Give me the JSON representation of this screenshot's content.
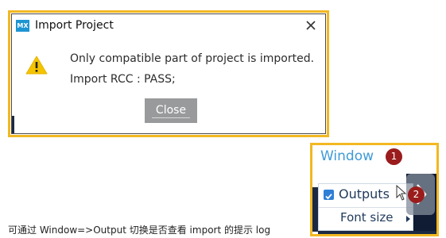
{
  "dialog": {
    "title": "Import Project",
    "app_icon_text": "MX",
    "message_line1": "Only compatible part of project is imported.",
    "message_line2": "Import RCC : PASS;",
    "close_button_label": "Close",
    "close_icon": "close-icon",
    "warning_icon": "warning-icon"
  },
  "window_menu": {
    "title": "Window",
    "badge1": "1",
    "badge2": "2",
    "outputs_label": "Outputs",
    "outputs_checked": true,
    "font_size_label": "Font size"
  },
  "caption": "可通过 Window=>Output 切换是否查看 import 的提示 log",
  "colors": {
    "highlight_border": "#f2b822",
    "mx_icon": "#1e95d3",
    "warning": "#f5c400",
    "badge": "#9a1c1c",
    "menu_title": "#3f9ad8",
    "button_gray": "#999a9b"
  }
}
